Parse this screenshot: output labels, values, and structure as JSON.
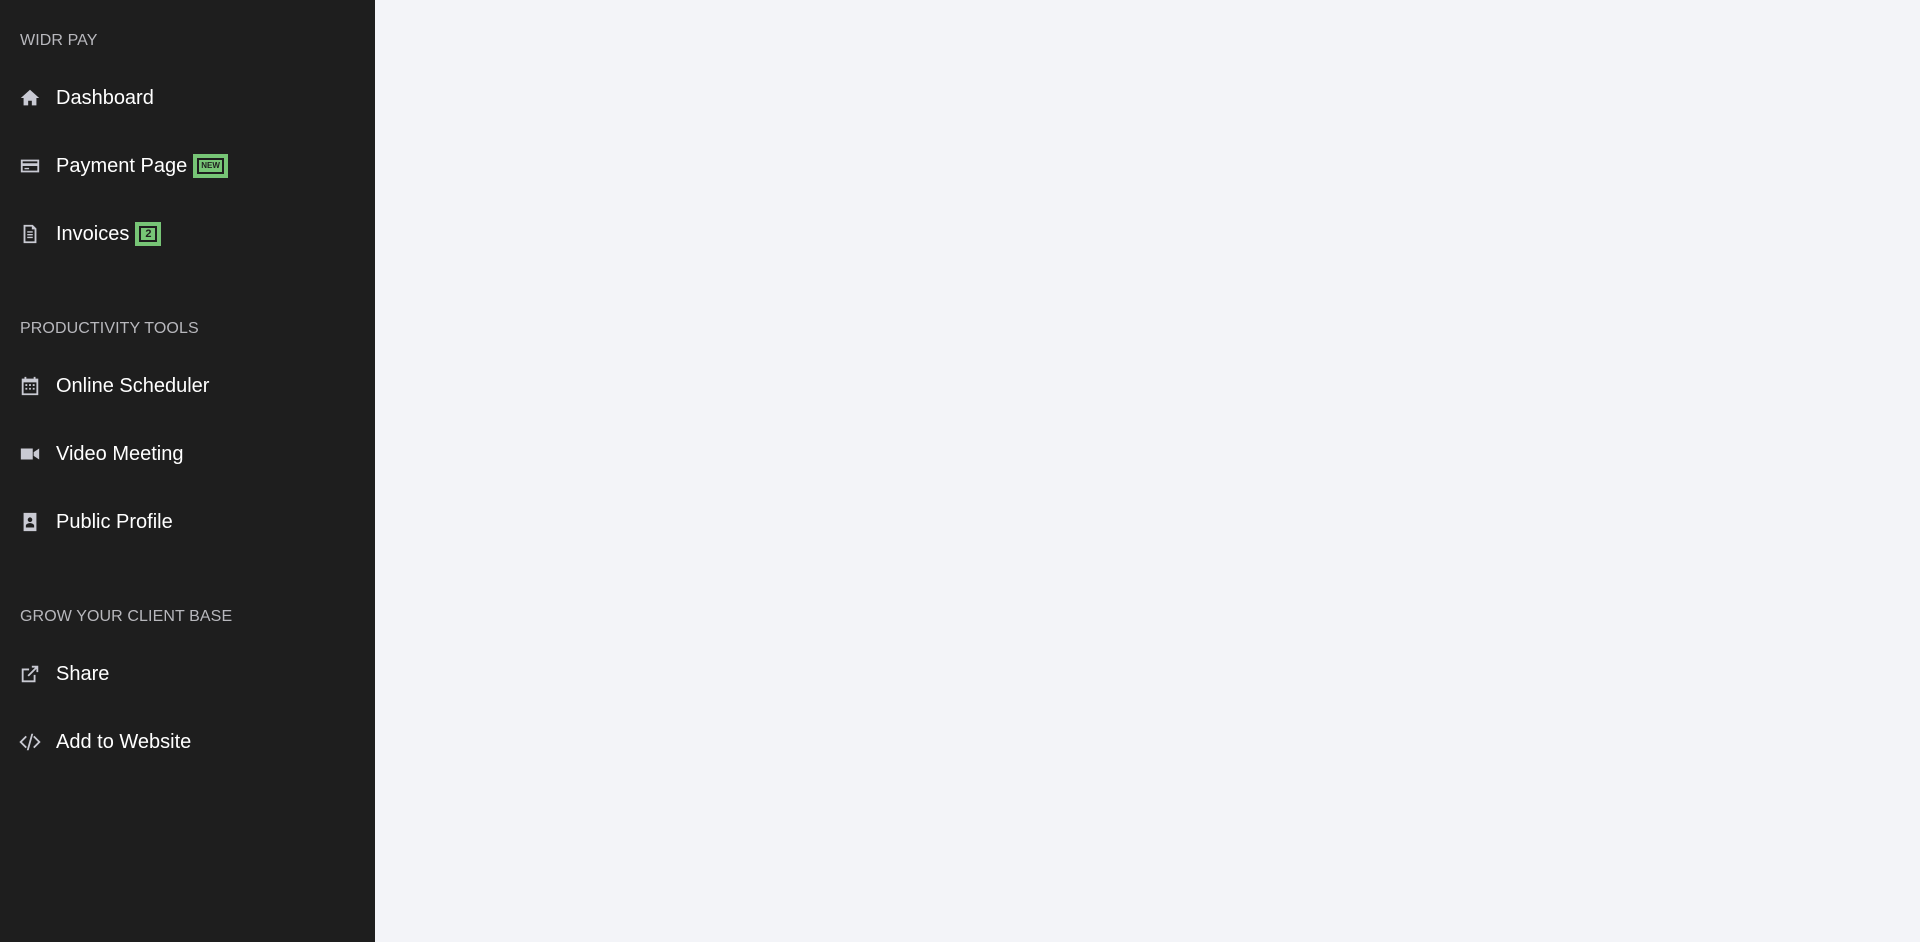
{
  "sidebar": {
    "sections": [
      {
        "title": "WIDR PAY",
        "items": [
          {
            "label": "Dashboard",
            "icon": "home-icon"
          },
          {
            "label": "Payment Page",
            "icon": "credit-card-icon",
            "badge": "NEW"
          },
          {
            "label": "Invoices",
            "icon": "invoice-icon",
            "badge": "2"
          }
        ]
      },
      {
        "title": "PRODUCTIVITY TOOLS",
        "items": [
          {
            "label": "Online Scheduler",
            "icon": "calendar-icon"
          },
          {
            "label": "Video Meeting",
            "icon": "video-camera-icon"
          },
          {
            "label": "Public Profile",
            "icon": "profile-badge-icon"
          }
        ]
      },
      {
        "title": "GROW YOUR CLIENT BASE",
        "items": [
          {
            "label": "Share",
            "icon": "external-link-icon"
          },
          {
            "label": "Add to Website",
            "icon": "code-icon"
          }
        ]
      }
    ]
  },
  "colors": {
    "sidebar_bg": "#1e1e1e",
    "main_bg": "#f3f4f8",
    "badge_green": "#77c576",
    "icon_gray": "#c9cad3",
    "section_title": "#b8b8bd"
  }
}
